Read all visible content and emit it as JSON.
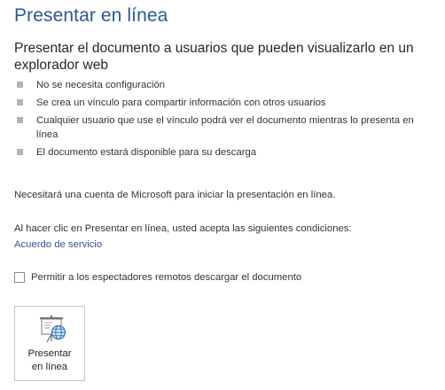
{
  "header": {
    "title": "Presentar en línea",
    "subtitle": "Presentar el documento a usuarios que pueden visualizarlo en un explorador web"
  },
  "bullets": [
    "No se necesita configuración",
    "Se crea un vínculo para compartir información con otros usuarios",
    "Cualquier usuario que use el vínculo podrá ver el documento mientras lo presenta en línea",
    "El documento estará disponible para su descarga"
  ],
  "notes": {
    "account": "Necesitará una cuenta de Microsoft para iniciar la presentación en línea.",
    "terms": "Al hacer clic en Presentar en línea, usted acepta las siguientes condiciones:",
    "service_link": "Acuerdo de servicio"
  },
  "checkbox": {
    "label": "Permitir a los espectadores remotos descargar el documento",
    "checked": false
  },
  "button": {
    "label_line1": "Presentar",
    "label_line2": "en línea",
    "icon": "present-online-icon"
  },
  "colors": {
    "accent": "#2b579a",
    "text": "#262626",
    "bullet": "#b3b3b3",
    "icon_blue": "#2e75b6"
  }
}
